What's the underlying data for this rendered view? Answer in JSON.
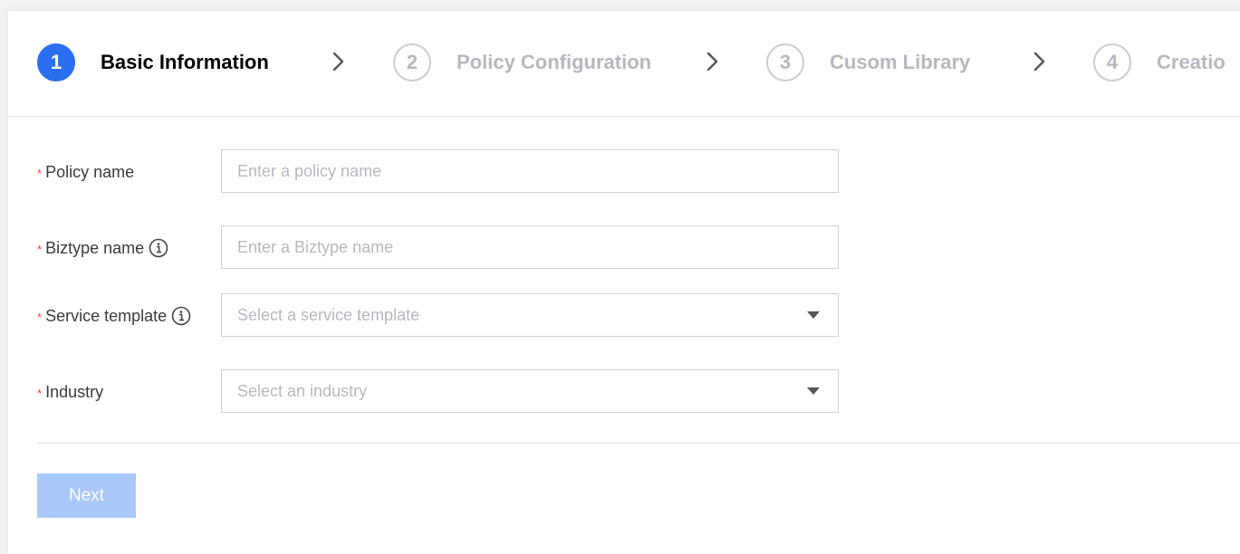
{
  "stepper": {
    "steps": [
      {
        "number": "1",
        "label": "Basic Information",
        "state": "active"
      },
      {
        "number": "2",
        "label": "Policy Configuration",
        "state": "inactive"
      },
      {
        "number": "3",
        "label": "Cusom Library",
        "state": "inactive"
      },
      {
        "number": "4",
        "label": "Creatio",
        "state": "inactive"
      }
    ]
  },
  "form": {
    "required_mark": "*",
    "policy_name": {
      "label": "Policy name",
      "placeholder": "Enter a policy name"
    },
    "biztype_name": {
      "label": "Biztype name",
      "placeholder": "Enter a Biztype name"
    },
    "service_template": {
      "label": "Service template",
      "placeholder": "Select a service template"
    },
    "industry": {
      "label": "Industry",
      "placeholder": "Select an industry"
    }
  },
  "actions": {
    "next_label": "Next"
  },
  "colors": {
    "accent": "#2b6ff0",
    "required": "#e54545",
    "disabled_button": "#a9c9fa",
    "muted_text": "#b4b8bf"
  },
  "icons": {
    "step_separator": "chevron-right-icon",
    "field_help": "info-circle-icon",
    "dropdown": "caret-down-icon"
  }
}
